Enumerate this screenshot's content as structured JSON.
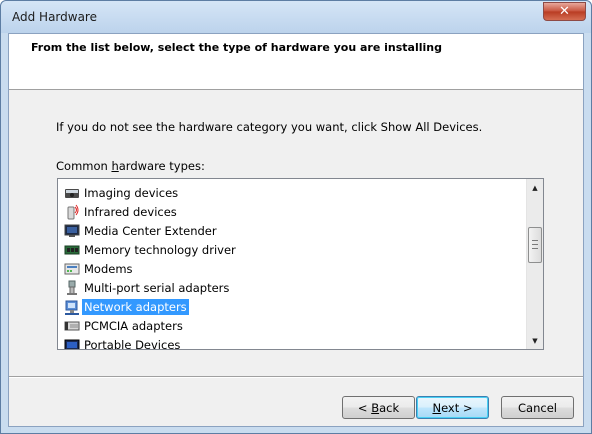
{
  "window": {
    "title": "Add Hardware",
    "close_label": "✕"
  },
  "header": {
    "text": "From the list below, select the type of hardware you are installing"
  },
  "instruction": "If you do not see the hardware category you want, click Show All Devices.",
  "list_label": {
    "prefix": "Common ",
    "mnemonic": "h",
    "suffix": "ardware types:"
  },
  "hardware_types": [
    {
      "label": "Imaging devices",
      "icon": "imaging-device-icon"
    },
    {
      "label": "Infrared devices",
      "icon": "infrared-device-icon"
    },
    {
      "label": "Media Center Extender",
      "icon": "media-center-icon"
    },
    {
      "label": "Memory technology driver",
      "icon": "memory-chip-icon"
    },
    {
      "label": "Modems",
      "icon": "modem-icon"
    },
    {
      "label": "Multi-port serial adapters",
      "icon": "serial-adapter-icon"
    },
    {
      "label": "Network adapters",
      "icon": "network-adapter-icon",
      "selected": true
    },
    {
      "label": "PCMCIA adapters",
      "icon": "pcmcia-icon"
    },
    {
      "label": "Portable Devices",
      "icon": "portable-device-icon"
    }
  ],
  "scrollbar": {
    "up_arrow": "▲",
    "down_arrow": "▼"
  },
  "buttons": {
    "back_mnemonic": "B",
    "back_rest": "ack",
    "back_prefix": "< ",
    "next_mnemonic": "N",
    "next_rest": "ext >",
    "cancel": "Cancel"
  },
  "colors": {
    "selection": "#3399ff",
    "client_bg": "#f0f0f0",
    "frame": "#c9dcef"
  }
}
